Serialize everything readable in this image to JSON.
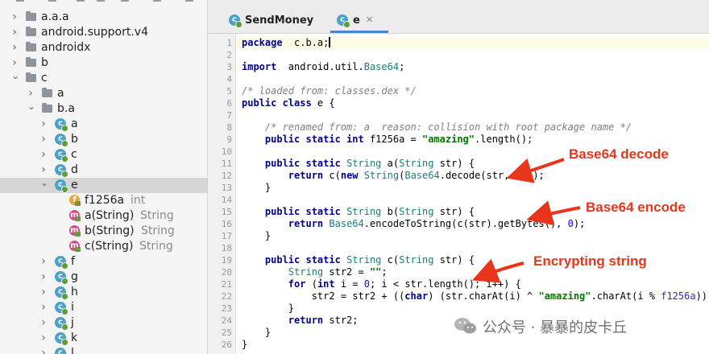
{
  "tree": {
    "rows": [
      {
        "label": "a.a.a",
        "kind": "package",
        "depth": 0,
        "expanded": false
      },
      {
        "label": "android.support.v4",
        "kind": "package",
        "depth": 0,
        "expanded": false
      },
      {
        "label": "androidx",
        "kind": "package",
        "depth": 0,
        "expanded": false
      },
      {
        "label": "b",
        "kind": "package",
        "depth": 0,
        "expanded": false
      },
      {
        "label": "c",
        "kind": "package",
        "depth": 0,
        "expanded": true
      },
      {
        "label": "a",
        "kind": "package",
        "depth": 1,
        "expanded": false
      },
      {
        "label": "b.a",
        "kind": "package",
        "depth": 1,
        "expanded": true
      },
      {
        "label": "a",
        "kind": "class",
        "depth": 2,
        "expanded": false
      },
      {
        "label": "b",
        "kind": "class",
        "depth": 2,
        "expanded": false
      },
      {
        "label": "c",
        "kind": "class",
        "depth": 2,
        "expanded": false
      },
      {
        "label": "d",
        "kind": "class",
        "depth": 2,
        "expanded": false
      },
      {
        "label": "e",
        "kind": "class",
        "depth": 2,
        "expanded": true,
        "selected": true
      },
      {
        "label": "f1256a",
        "type": "int",
        "kind": "field",
        "depth": 3
      },
      {
        "label": "a(String)",
        "type": "String",
        "kind": "method",
        "depth": 3
      },
      {
        "label": "b(String)",
        "type": "String",
        "kind": "method",
        "depth": 3
      },
      {
        "label": "c(String)",
        "type": "String",
        "kind": "method",
        "depth": 3
      },
      {
        "label": "f",
        "kind": "class",
        "depth": 2,
        "expanded": false
      },
      {
        "label": "g",
        "kind": "class",
        "depth": 2,
        "expanded": false
      },
      {
        "label": "h",
        "kind": "class",
        "depth": 2,
        "expanded": false
      },
      {
        "label": "i",
        "kind": "class",
        "depth": 2,
        "expanded": false
      },
      {
        "label": "j",
        "kind": "class",
        "depth": 2,
        "expanded": false
      },
      {
        "label": "k",
        "kind": "class",
        "depth": 2,
        "expanded": false
      },
      {
        "label": "l",
        "kind": "class",
        "depth": 2,
        "expanded": false
      }
    ]
  },
  "tabs": [
    {
      "label": "SendMoney",
      "active": false
    },
    {
      "label": "e",
      "active": true
    }
  ],
  "code": {
    "lines": [
      [
        [
          "kw",
          "package"
        ],
        [
          "",
          "  c.b.a;"
        ],
        [
          "caret",
          ""
        ]
      ],
      [],
      [
        [
          "kw",
          "import"
        ],
        [
          "",
          "  android.util."
        ],
        [
          "imp",
          "Base64"
        ],
        [
          "",
          ";"
        ]
      ],
      [],
      [
        [
          "cm",
          "/* loaded from: classes.dex */"
        ]
      ],
      [
        [
          "kw",
          "public class"
        ],
        [
          "",
          " e {"
        ]
      ],
      [],
      [
        [
          "",
          "    "
        ],
        [
          "cm",
          "/* renamed from: a  reason: collision with root package name */"
        ]
      ],
      [
        [
          "",
          "    "
        ],
        [
          "kw",
          "public static int"
        ],
        [
          "",
          " f1256a = "
        ],
        [
          "st",
          "\"amazing\""
        ],
        [
          "",
          ".length();"
        ]
      ],
      [],
      [
        [
          "",
          "    "
        ],
        [
          "kw",
          "public static"
        ],
        [
          "",
          " "
        ],
        [
          "ty",
          "String"
        ],
        [
          "",
          " a("
        ],
        [
          "ty",
          "String"
        ],
        [
          "",
          " str) {"
        ]
      ],
      [
        [
          "",
          "        "
        ],
        [
          "kw",
          "return"
        ],
        [
          "",
          " c("
        ],
        [
          "kw",
          "new"
        ],
        [
          "",
          " "
        ],
        [
          "ty",
          "String"
        ],
        [
          "",
          "("
        ],
        [
          "imp",
          "Base64"
        ],
        [
          "",
          ".decode(str, "
        ],
        [
          "num",
          "0"
        ],
        [
          "",
          ")));"
        ]
      ],
      [
        [
          "",
          "    }"
        ]
      ],
      [],
      [
        [
          "",
          "    "
        ],
        [
          "kw",
          "public static"
        ],
        [
          "",
          " "
        ],
        [
          "ty",
          "String"
        ],
        [
          "",
          " b("
        ],
        [
          "ty",
          "String"
        ],
        [
          "",
          " str) {"
        ]
      ],
      [
        [
          "",
          "        "
        ],
        [
          "kw",
          "return"
        ],
        [
          "",
          " "
        ],
        [
          "imp",
          "Base64"
        ],
        [
          "",
          ".encodeToString(c(str).getBytes(), "
        ],
        [
          "num",
          "0"
        ],
        [
          "",
          ");"
        ]
      ],
      [
        [
          "",
          "    }"
        ]
      ],
      [],
      [
        [
          "",
          "    "
        ],
        [
          "kw",
          "public static"
        ],
        [
          "",
          " "
        ],
        [
          "ty",
          "String"
        ],
        [
          "",
          " c("
        ],
        [
          "ty",
          "String"
        ],
        [
          "",
          " str) {"
        ]
      ],
      [
        [
          "",
          "        "
        ],
        [
          "ty",
          "String"
        ],
        [
          "",
          " str2 = "
        ],
        [
          "st",
          "\"\""
        ],
        [
          "",
          ";"
        ]
      ],
      [
        [
          "",
          "        "
        ],
        [
          "kw",
          "for"
        ],
        [
          "",
          " ("
        ],
        [
          "kw",
          "int"
        ],
        [
          "",
          " i = "
        ],
        [
          "num",
          "0"
        ],
        [
          "",
          "; i < str.length(); i++) {"
        ]
      ],
      [
        [
          "",
          "            str2 = str2 + (("
        ],
        [
          "kw",
          "char"
        ],
        [
          "",
          ") (str.charAt(i) ^ "
        ],
        [
          "st",
          "\"amazing\""
        ],
        [
          "",
          ".charAt(i % "
        ],
        [
          "fld",
          "f1256a"
        ],
        [
          "",
          ")));"
        ]
      ],
      [
        [
          "",
          "        }"
        ]
      ],
      [
        [
          "",
          "        "
        ],
        [
          "kw",
          "return"
        ],
        [
          "",
          " str2;"
        ]
      ],
      [
        [
          "",
          "    }"
        ]
      ],
      [
        [
          "",
          "}"
        ]
      ]
    ]
  },
  "annotations": {
    "decode": "Base64 decode",
    "encode": "Base64 encode",
    "encrypt": "Encrypting string"
  },
  "colors": {
    "annotation": "#e8351c",
    "keyword": "#00008f",
    "string": "#007800",
    "comment": "#808080",
    "class_icon": "#4aa3c7"
  },
  "watermark": {
    "icon": "wechat-icon",
    "text": "公众号 · 暴暴的皮卡丘"
  }
}
